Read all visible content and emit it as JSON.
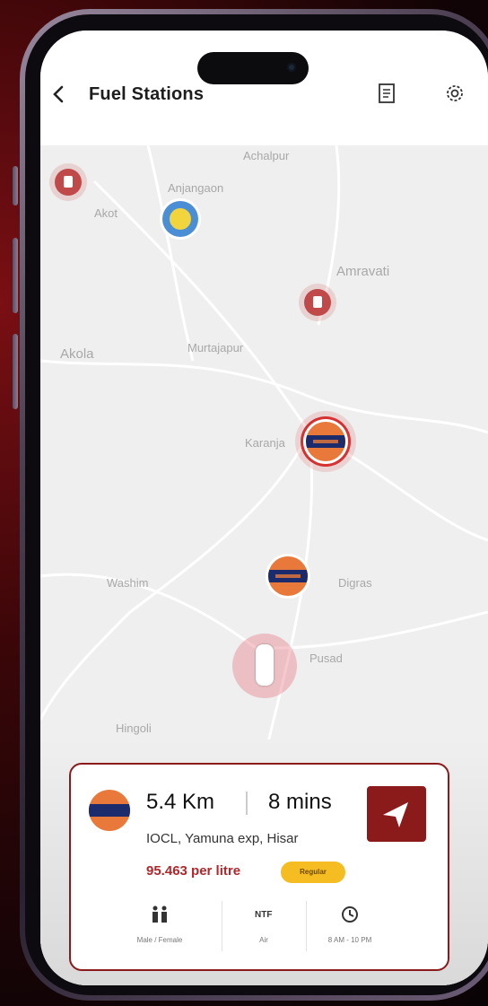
{
  "header": {
    "title": "Fuel Stations",
    "back_icon": "chevron-left-icon",
    "list_icon": "receipt-icon",
    "settings_icon": "gear-icon"
  },
  "map": {
    "labels": {
      "achalpur": "Achalpur",
      "anjangaon": "Anjangaon",
      "akot": "Akot",
      "amravati": "Amravati",
      "akola": "Akola",
      "murtajapur": "Murtajapur",
      "karanja": "Karanja",
      "washim": "Washim",
      "digras": "Digras",
      "pusad": "Pusad",
      "hingoli": "Hingoli"
    }
  },
  "card": {
    "distance": "5.4 Km",
    "eta": "8 mins",
    "station": "IOCL, Yamuna exp, Hisar",
    "price": "95.463 per litre",
    "badge": "Regular",
    "amenities": [
      {
        "icon": "restroom-icon",
        "label": "Male / Female"
      },
      {
        "icon": "air-icon",
        "label": "Air"
      },
      {
        "icon": "clock-icon",
        "label": "8 AM - 10 PM"
      }
    ]
  },
  "colors": {
    "accent": "#8b1a1a",
    "price": "#b3262b",
    "badge": "#f5bd22"
  }
}
